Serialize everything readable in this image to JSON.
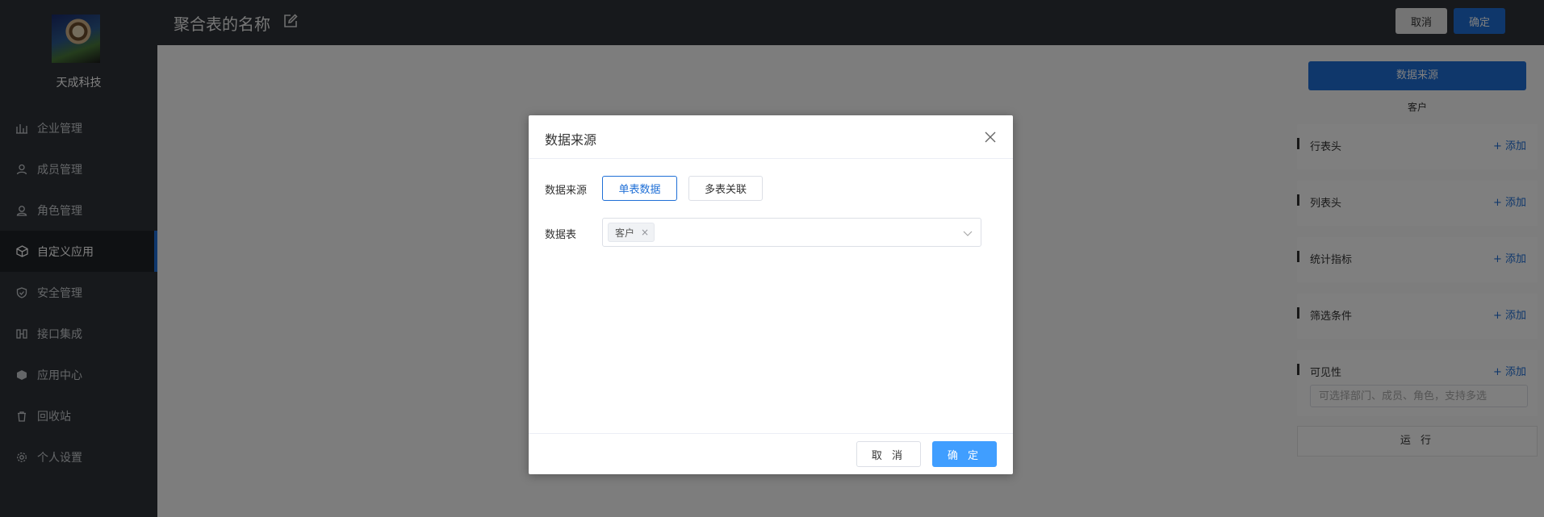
{
  "sidebar": {
    "company_name": "天成科技",
    "items": [
      {
        "label": "企业管理",
        "icon": "chart-icon"
      },
      {
        "label": "成员管理",
        "icon": "user-icon"
      },
      {
        "label": "角色管理",
        "icon": "role-icon"
      },
      {
        "label": "自定义应用",
        "icon": "cube-icon",
        "active": true
      },
      {
        "label": "安全管理",
        "icon": "shield-icon"
      },
      {
        "label": "接口集成",
        "icon": "interface-icon"
      },
      {
        "label": "应用中心",
        "icon": "app-icon"
      },
      {
        "label": "回收站",
        "icon": "trash-icon"
      },
      {
        "label": "个人设置",
        "icon": "gear-icon"
      }
    ]
  },
  "header": {
    "title": "聚合表的名称",
    "cancel_label": "取消",
    "confirm_label": "确定"
  },
  "right_panel": {
    "data_source_button": "数据来源",
    "data_source_value": "客户",
    "sections": [
      {
        "label": "行表头",
        "add_label": "+ 添加"
      },
      {
        "label": "列表头",
        "add_label": "+ 添加"
      },
      {
        "label": "统计指标",
        "add_label": "+ 添加"
      },
      {
        "label": "筛选条件",
        "add_label": "+ 添加"
      },
      {
        "label": "可见性",
        "add_label": "+ 添加"
      }
    ],
    "visibility_placeholder": "可选择部门、成员、角色，支持多选",
    "run_label": "运 行"
  },
  "dialog": {
    "title": "数据来源",
    "source_label": "数据来源",
    "single_label": "单表数据",
    "multi_label": "多表关联",
    "table_label": "数据表",
    "selected_tag": "客户",
    "cancel_label": "取 消",
    "confirm_label": "确 定"
  },
  "colors": {
    "primary": "#1f6fd6",
    "dialog_primary": "#409eff",
    "sidebar_bg": "#2f3338"
  }
}
